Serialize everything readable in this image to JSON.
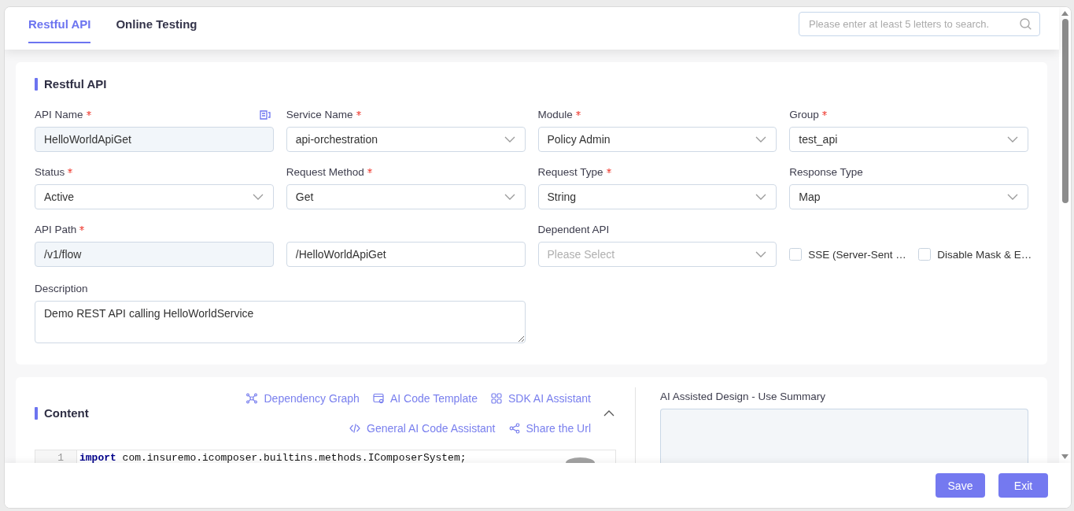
{
  "tabs": [
    {
      "label": "Restful API",
      "selected": true
    },
    {
      "label": "Online Testing",
      "selected": false
    }
  ],
  "search": {
    "placeholder": "Please enter at least 5 letters to search."
  },
  "api_section": {
    "title": "Restful API",
    "fields": [
      {
        "kind": "input",
        "label": "API Name",
        "required": true,
        "value": "HelloWorldApiGet",
        "disabled": true,
        "action_icon": true
      },
      {
        "kind": "select",
        "label": "Service Name",
        "required": true,
        "value": "api-orchestration",
        "disabled": false
      },
      {
        "kind": "select",
        "label": "Module",
        "required": true,
        "value": "Policy Admin",
        "disabled": false
      },
      {
        "kind": "select",
        "label": "Group",
        "required": true,
        "value": "test_api",
        "disabled": false
      },
      {
        "kind": "select",
        "label": "Status",
        "required": true,
        "value": "Active",
        "disabled": false
      },
      {
        "kind": "select",
        "label": "Request Method",
        "required": true,
        "value": "Get",
        "disabled": false
      },
      {
        "kind": "select",
        "label": "Request Type",
        "required": true,
        "value": "String",
        "disabled": false
      },
      {
        "kind": "select",
        "label": "Response Type",
        "required": false,
        "value": "Map",
        "disabled": false
      },
      {
        "kind": "input",
        "label": "API Path",
        "required": true,
        "value": "/v1/flow",
        "disabled": true
      },
      {
        "kind": "input",
        "value": "/HelloWorldApiGet",
        "disabled": false
      },
      {
        "kind": "select",
        "label": "Dependent API",
        "required": false,
        "placeholder": "Please Select",
        "disabled": false
      },
      {
        "kind": "checkboxes",
        "items": [
          {
            "label": "SSE (Server-Sent …",
            "checked": false
          },
          {
            "label": "Disable Mask & E…",
            "checked": false
          }
        ]
      },
      {
        "kind": "textarea",
        "label": "Description",
        "required": false,
        "value": "Demo REST API calling HelloWorldService",
        "disabled": false
      }
    ]
  },
  "content_section": {
    "title": "Content",
    "expanded": true,
    "toolbar_rows": [
      [
        "Dependency Graph",
        "AI Code Template",
        "SDK AI Assistant"
      ],
      [
        "General AI Code Assistant",
        "Share the Url"
      ]
    ],
    "editor": {
      "lines": [
        {
          "number": "1",
          "text": "**import** com.insuremo.icomposer.builtins.methods.IComposerSystem;"
        }
      ]
    }
  },
  "summary_panel": {
    "label": "AI Assisted Design - Use Summary"
  },
  "footer": {
    "buttons": [
      "Save",
      "Exit"
    ]
  }
}
